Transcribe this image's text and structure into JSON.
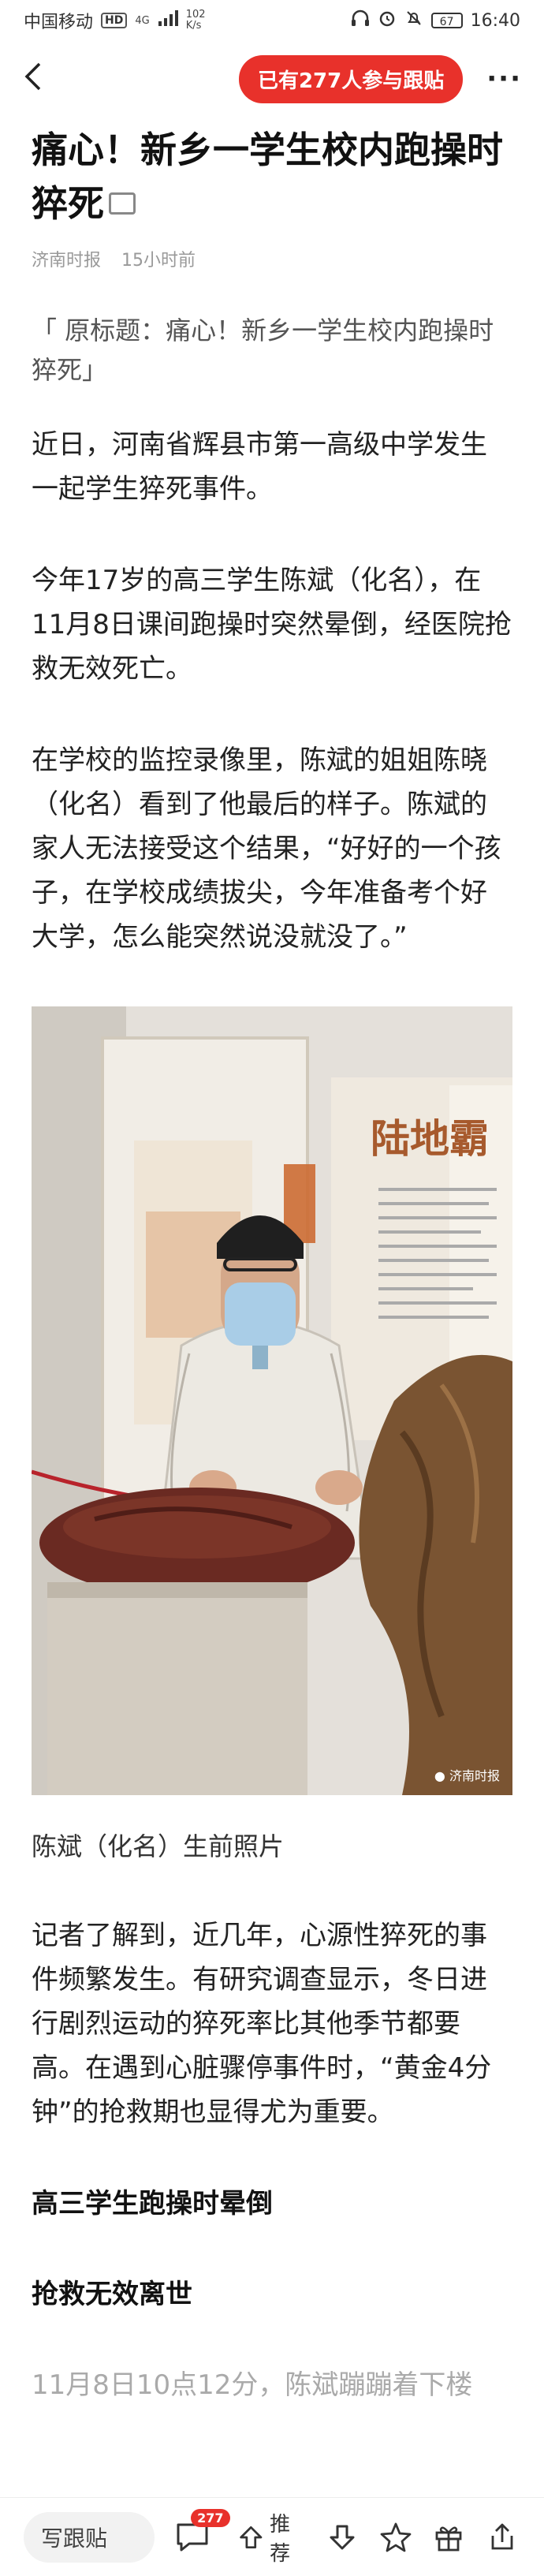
{
  "status_bar": {
    "carrier": "中国移动",
    "hd": "HD",
    "network": "4G",
    "speed_value": "102",
    "speed_unit": "K/s",
    "battery": "67",
    "time": "16:40"
  },
  "nav": {
    "follow_label": "已有277人参与跟贴",
    "more_label": "···"
  },
  "article": {
    "title": "痛心！新乡一学生校内跑操时猝死",
    "source": "济南时报",
    "time_ago": "15小时前",
    "quote": "「 原标题：痛心！新乡一学生校内跑操时猝死」",
    "paragraphs": [
      "近日，河南省辉县市第一高级中学发生一起学生猝死事件。",
      "今年17岁的高三学生陈斌（化名），在11月8日课间跑操时突然晕倒，经医院抢救无效死亡。",
      "在学校的监控录像里，陈斌的姐姐陈晓（化名）看到了他最后的样子。陈斌的家人无法接受这个结果，“好好的一个孩子，在学校成绩拔尖，今年准备考个好大学，怎么能突然说没就没了。”"
    ],
    "photo": {
      "panel_text": "陆地霸",
      "watermark": "济南时报"
    },
    "caption": "陈斌（化名）生前照片",
    "paragraph_after": "记者了解到，近几年，心源性猝死的事件频繁发生。有研究调查显示，冬日进行剧烈运动的猝死率比其他季节都要高。在遇到心脏骤停事件时，“黄金4分钟”的抢救期也显得尤为重要。",
    "subheads": [
      "高三学生跑操时晕倒",
      "抢救无效离世"
    ],
    "faded_paragraph": "11月8日10点12分，陈斌蹦蹦着下楼"
  },
  "bottom_bar": {
    "comment_placeholder": "写跟贴",
    "comment_count": "277",
    "vote_label": "推荐"
  },
  "colors": {
    "accent": "#e8312b"
  }
}
